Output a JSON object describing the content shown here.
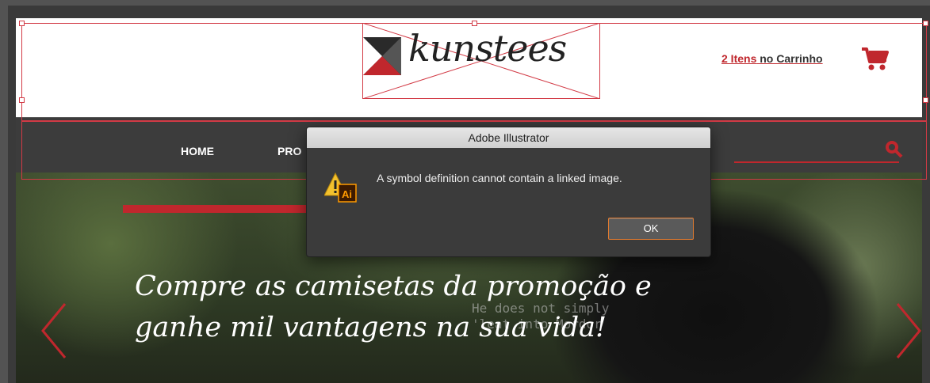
{
  "site": {
    "logo_text": "kunstees",
    "cart": {
      "count_text": "2 Itens",
      "rest_text": " no Carrinho"
    },
    "nav": [
      "HOME",
      "PRO"
    ],
    "hero": {
      "line1": "Compre as camisetas da promoção e",
      "line2": "ganhe mil vantagens na sua vida!",
      "overlay_line1": "He does not simply",
      "overlay_line2": "'leat into Mordor"
    }
  },
  "dialog": {
    "title": "Adobe Illustrator",
    "message": "A symbol definition cannot contain a linked image.",
    "ok_label": "OK",
    "icon": "warning-illustrator-icon"
  },
  "colors": {
    "brand_red": "#c0272d",
    "selection": "#d23a45",
    "ok_focus": "#e07a2f"
  }
}
